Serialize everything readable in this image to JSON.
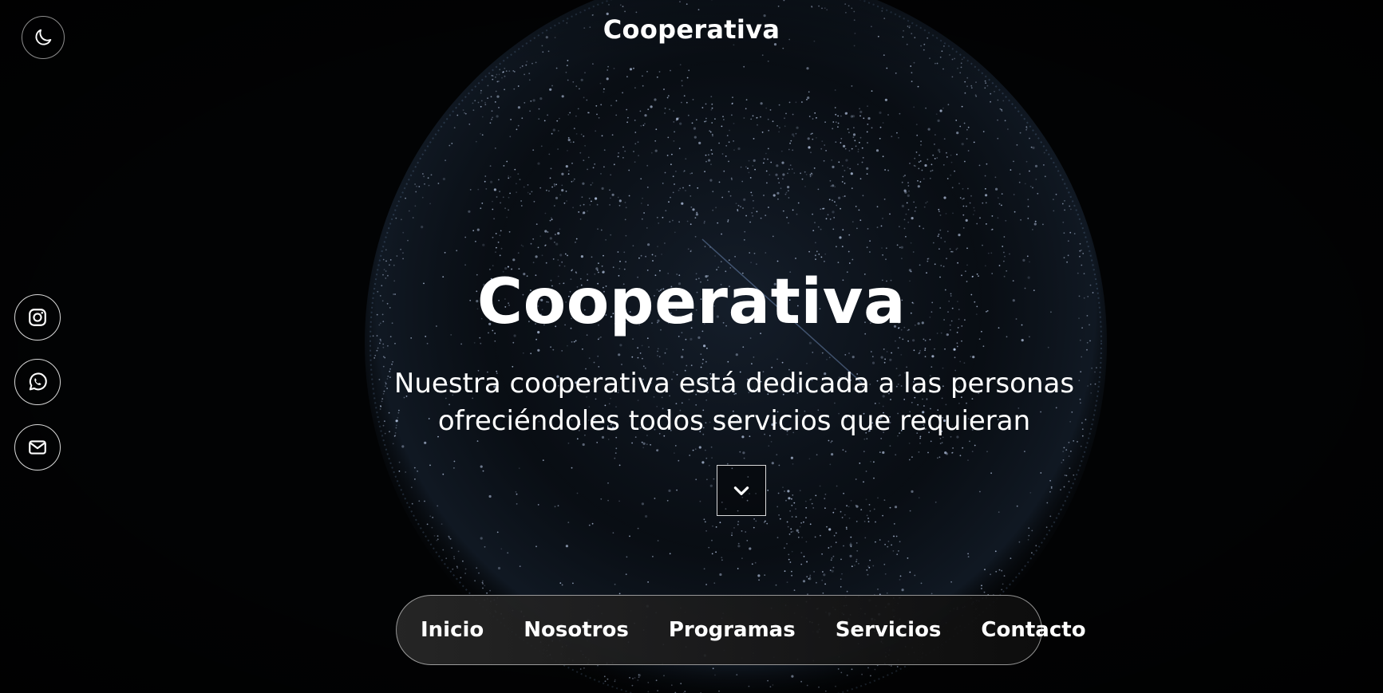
{
  "header": {
    "brand": "Cooperativa",
    "theme_toggle_icon": "moon-icon"
  },
  "social": [
    {
      "icon": "instagram-icon"
    },
    {
      "icon": "whatsapp-icon"
    },
    {
      "icon": "mail-icon"
    }
  ],
  "hero": {
    "title": "Cooperativa",
    "subtitle": "Nuestra cooperativa está dedicada a las personas ofreciéndoles todos servicios que requieran",
    "scroll_icon": "chevron-down-icon"
  },
  "nav": {
    "items": [
      {
        "label": "Inicio"
      },
      {
        "label": "Nosotros"
      },
      {
        "label": "Programas"
      },
      {
        "label": "Servicios"
      },
      {
        "label": "Contacto"
      }
    ]
  },
  "colors": {
    "background": "#020304",
    "text": "#ffffff",
    "globe_glow": "#9fc4ff"
  }
}
